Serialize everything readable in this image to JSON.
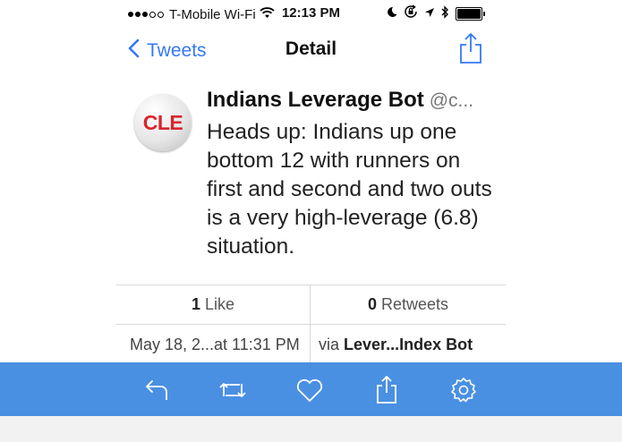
{
  "status_bar": {
    "signal_bars_filled": 3,
    "signal_bars_total": 5,
    "carrier": "T-Mobile Wi-Fi",
    "time": "12:13 PM",
    "icons": [
      "wifi-icon",
      "moon-icon",
      "rotation-lock-icon",
      "location-icon",
      "bluetooth-icon",
      "battery-icon"
    ]
  },
  "nav": {
    "back_label": "Tweets",
    "title": "Detail",
    "share_icon": "share-icon"
  },
  "tweet": {
    "avatar_text": "CLE",
    "author_name": "Indians Leverage Bot",
    "handle": "@c...",
    "text": "Heads up: Indians up one bottom 12 with runners on first and second and two outs is a very high-leverage (6.8) situation."
  },
  "stats": {
    "likes_count": "1",
    "likes_label": "Like",
    "retweets_count": "0",
    "retweets_label": "Retweets"
  },
  "meta": {
    "date": "May 18, 2...at 11:31 PM",
    "via_prefix": "via",
    "via_app": "Lever...Index Bot"
  },
  "toolbar": {
    "items": [
      "reply-icon",
      "retweet-icon",
      "like-icon",
      "share-icon",
      "settings-icon"
    ],
    "background": "#4a90e2"
  },
  "colors": {
    "accent": "#3478f6",
    "avatar_text": "#d9262e"
  }
}
